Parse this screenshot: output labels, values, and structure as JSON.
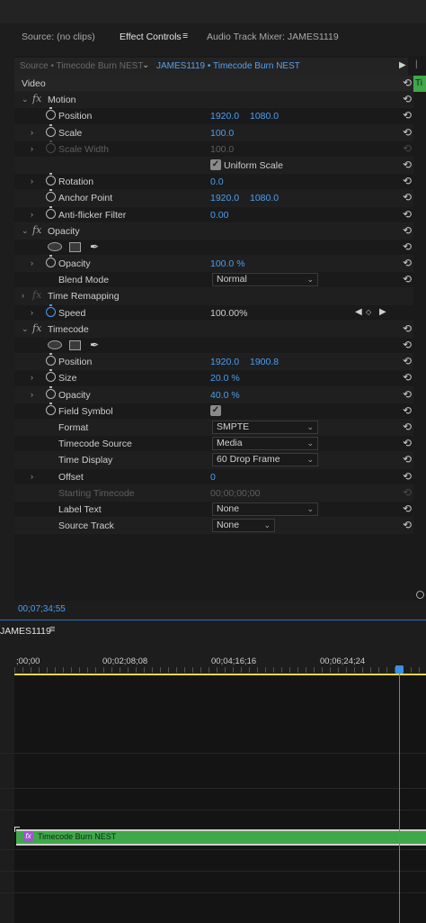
{
  "tabs": {
    "source": "Source: (no clips)",
    "effect_controls": "Effect Controls",
    "menu_icon": "≡",
    "audio_mixer": "Audio Track Mixer: JAMES1119"
  },
  "source_bar": {
    "left": "Source • Timecode Burn NEST",
    "right": "JAMES1119 • Timecode Burn NEST",
    "mini_clip": "Ti"
  },
  "rows": [
    {
      "type": "section",
      "label": "Video",
      "reset": false
    },
    {
      "type": "fx",
      "label": "Motion",
      "chev": "v"
    },
    {
      "type": "prop",
      "label": "Position",
      "v1": "1920.0",
      "v2": "1080.0"
    },
    {
      "type": "prop",
      "label": "Scale",
      "v1": "100.0",
      "chev": ">"
    },
    {
      "type": "prop",
      "label": "Scale Width",
      "v1": "100.0",
      "chev": ">",
      "dim": true
    },
    {
      "type": "check",
      "label": "Uniform Scale"
    },
    {
      "type": "prop",
      "label": "Rotation",
      "v1": "0.0",
      "chev": ">"
    },
    {
      "type": "prop",
      "label": "Anchor Point",
      "v1": "1920.0",
      "v2": "1080.0"
    },
    {
      "type": "prop",
      "label": "Anti-flicker Filter",
      "v1": "0.00",
      "chev": ">"
    },
    {
      "type": "fx",
      "label": "Opacity",
      "chev": "v"
    },
    {
      "type": "shapes"
    },
    {
      "type": "prop",
      "label": "Opacity",
      "v1": "100.0 %",
      "chev": ">"
    },
    {
      "type": "dropdown",
      "label": "Blend Mode",
      "value": "Normal",
      "w": 118
    },
    {
      "type": "fx",
      "label": "Time Remapping",
      "chev": ">",
      "dimfx": true,
      "noreset": true
    },
    {
      "type": "speed",
      "label": "Speed",
      "v1": "100.00%",
      "chev": ">"
    },
    {
      "type": "fx",
      "label": "Timecode",
      "chev": "v"
    },
    {
      "type": "shapes"
    },
    {
      "type": "prop",
      "label": "Position",
      "v1": "1920.0",
      "v2": "1900.8"
    },
    {
      "type": "prop",
      "label": "Size",
      "v1": "20.0 %",
      "chev": ">"
    },
    {
      "type": "prop",
      "label": "Opacity",
      "v1": "40.0 %",
      "chev": ">"
    },
    {
      "type": "checkprop",
      "label": "Field Symbol"
    },
    {
      "type": "dropdown",
      "label": "Format",
      "value": "SMPTE",
      "w": 118
    },
    {
      "type": "dropdown",
      "label": "Timecode Source",
      "value": "Media",
      "w": 118
    },
    {
      "type": "dropdown",
      "label": "Time Display",
      "value": "60 Drop Frame",
      "w": 118
    },
    {
      "type": "prop",
      "label": "Offset",
      "v1": "0",
      "chev": ">",
      "nosw": true
    },
    {
      "type": "prop",
      "label": "Starting Timecode",
      "v1": "00;00;00;00",
      "nosw": true,
      "dim": true
    },
    {
      "type": "dropdown",
      "label": "Label Text",
      "value": "None",
      "w": 118
    },
    {
      "type": "dropdown",
      "label": "Source Track",
      "value": "None",
      "w": 70
    }
  ],
  "ec_timecode": "00;07;34;55",
  "timeline": {
    "title": "JAMES1119",
    "menu_icon": "≡",
    "ticks": [
      {
        "label": ";00;00"
      },
      {
        "label": "00;02;08;08"
      },
      {
        "label": "00;04;16;16"
      },
      {
        "label": "00;06;24;24"
      }
    ],
    "clip_name": "Timecode Burn NEST",
    "clip_fx": "fx"
  },
  "colors": {
    "accent": "#4a9ff0",
    "clip": "#3fa84a",
    "work_area": "#e3d84a"
  }
}
